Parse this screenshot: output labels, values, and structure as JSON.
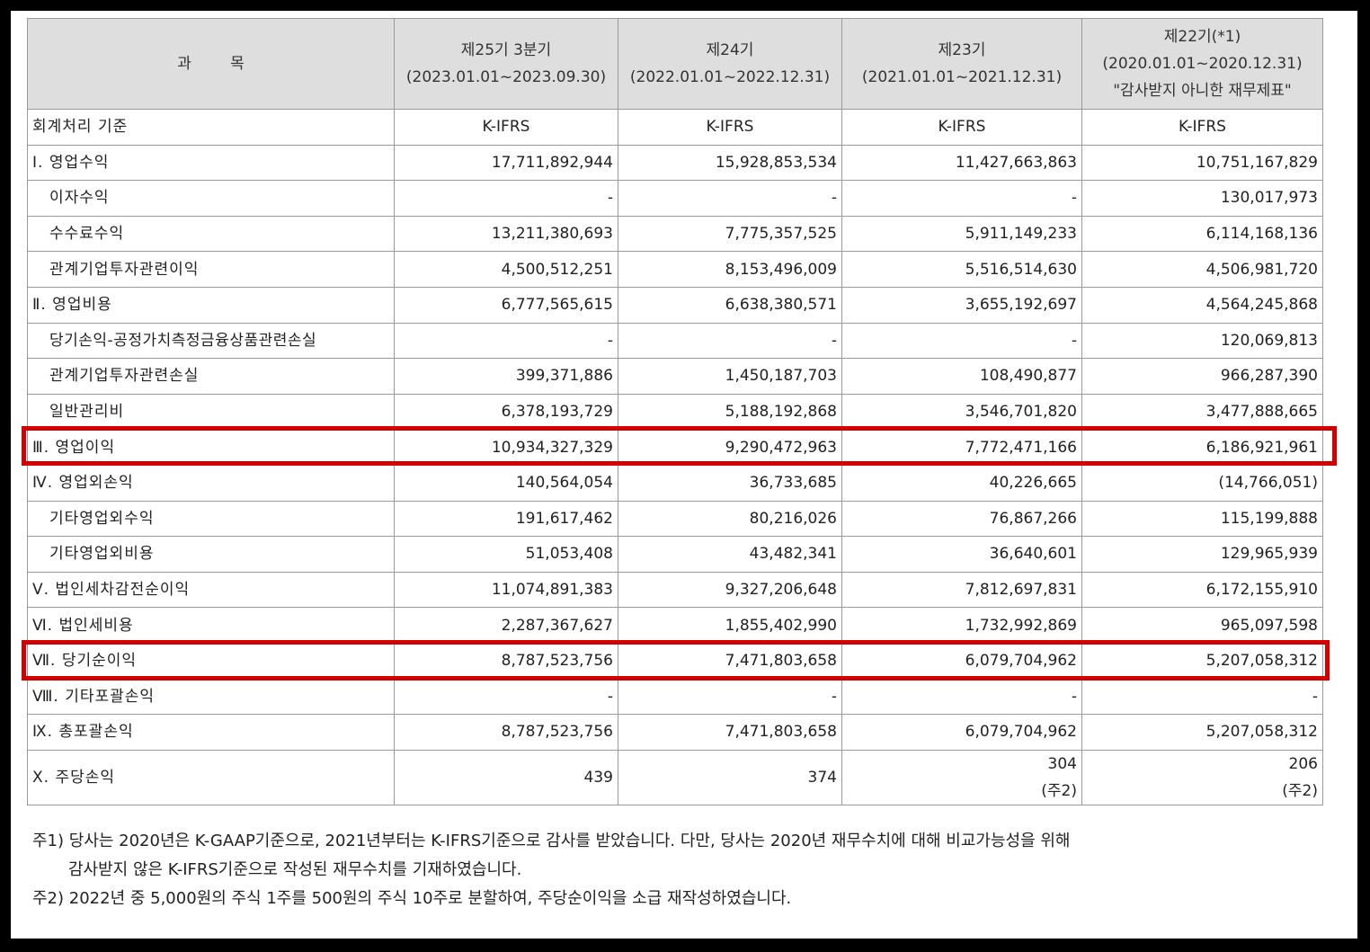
{
  "header": {
    "subject": "과        목",
    "col1": {
      "line1": "제25기 3분기",
      "line2": "(2023.01.01~2023.09.30)"
    },
    "col2": {
      "line1": "제24기",
      "line2": "(2022.01.01~2022.12.31)"
    },
    "col3": {
      "line1": "제23기",
      "line2": "(2021.01.01~2021.12.31)"
    },
    "col4": {
      "line1": "제22기(*1)",
      "line2": "(2020.01.01~2020.12.31)",
      "line3": "\"감사받지 아니한 재무제표\""
    }
  },
  "rows": [
    {
      "label": "회계처리 기준",
      "values": [
        "K-IFRS",
        "K-IFRS",
        "K-IFRS",
        "K-IFRS"
      ]
    },
    {
      "label": "Ⅰ. 영업수익",
      "values": [
        "17,711,892,944",
        "15,928,853,534",
        "11,427,663,863",
        "10,751,167,829"
      ]
    },
    {
      "label": "이자수익",
      "values": [
        "-",
        "-",
        "-",
        "130,017,973"
      ]
    },
    {
      "label": "수수료수익",
      "values": [
        "13,211,380,693",
        "7,775,357,525",
        "5,911,149,233",
        "6,114,168,136"
      ]
    },
    {
      "label": "관계기업투자관련이익",
      "values": [
        "4,500,512,251",
        "8,153,496,009",
        "5,516,514,630",
        "4,506,981,720"
      ]
    },
    {
      "label": "Ⅱ. 영업비용",
      "values": [
        "6,777,565,615",
        "6,638,380,571",
        "3,655,192,697",
        "4,564,245,868"
      ]
    },
    {
      "label": "당기손익-공정가치측정금융상품관련손실",
      "values": [
        "-",
        "-",
        "-",
        "120,069,813"
      ]
    },
    {
      "label": "관계기업투자관련손실",
      "values": [
        "399,371,886",
        "1,450,187,703",
        "108,490,877",
        "966,287,390"
      ]
    },
    {
      "label": "일반관리비",
      "values": [
        "6,378,193,729",
        "5,188,192,868",
        "3,546,701,820",
        "3,477,888,665"
      ]
    },
    {
      "label": "Ⅲ. 영업이익",
      "values": [
        "10,934,327,329",
        "9,290,472,963",
        "7,772,471,166",
        "6,186,921,961"
      ]
    },
    {
      "label": "Ⅳ. 영업외손익",
      "values": [
        "140,564,054",
        "36,733,685",
        "40,226,665",
        "(14,766,051)"
      ]
    },
    {
      "label": "기타영업외수익",
      "values": [
        "191,617,462",
        "80,216,026",
        "76,867,266",
        "115,199,888"
      ]
    },
    {
      "label": "기타영업외비용",
      "values": [
        "51,053,408",
        "43,482,341",
        "36,640,601",
        "129,965,939"
      ]
    },
    {
      "label": "Ⅴ. 법인세차감전순이익",
      "values": [
        "11,074,891,383",
        "9,327,206,648",
        "7,812,697,831",
        "6,172,155,910"
      ]
    },
    {
      "label": "Ⅵ. 법인세비용",
      "values": [
        "2,287,367,627",
        "1,855,402,990",
        "1,732,992,869",
        "965,097,598"
      ]
    },
    {
      "label": "Ⅶ. 당기순이익",
      "values": [
        "8,787,523,756",
        "7,471,803,658",
        "6,079,704,962",
        "5,207,058,312"
      ]
    },
    {
      "label": "Ⅷ. 기타포괄손익",
      "values": [
        "-",
        "-",
        "-",
        "-"
      ]
    },
    {
      "label": "Ⅸ. 총포괄손익",
      "values": [
        "8,787,523,756",
        "7,471,803,658",
        "6,079,704,962",
        "5,207,058,312"
      ]
    },
    {
      "label": "Ⅹ. 주당손익",
      "values": [
        "439",
        "374",
        "304",
        "206"
      ],
      "notes": [
        "",
        "",
        "(주2)",
        "(주2)"
      ]
    }
  ],
  "footnotes": {
    "note1_line1": "주1) 당사는 2020년은 K-GAAP기준으로, 2021년부터는 K-IFRS기준으로 감사를 받았습니다.  다만, 당사는 2020년 재무수치에 대해 비교가능성을 위해",
    "note1_line2": "감사받지 않은 K-IFRS기준으로 작성된 재무수치를 기재하였습니다.",
    "note2": "주2) 2022년 중 5,000원의 주식 1주를  500원의 주식 10주로 분할하여, 주당순이익을 소급 재작성하였습니다."
  },
  "colors": {
    "highlight": "#d40000",
    "header_bg": "#dedede"
  }
}
